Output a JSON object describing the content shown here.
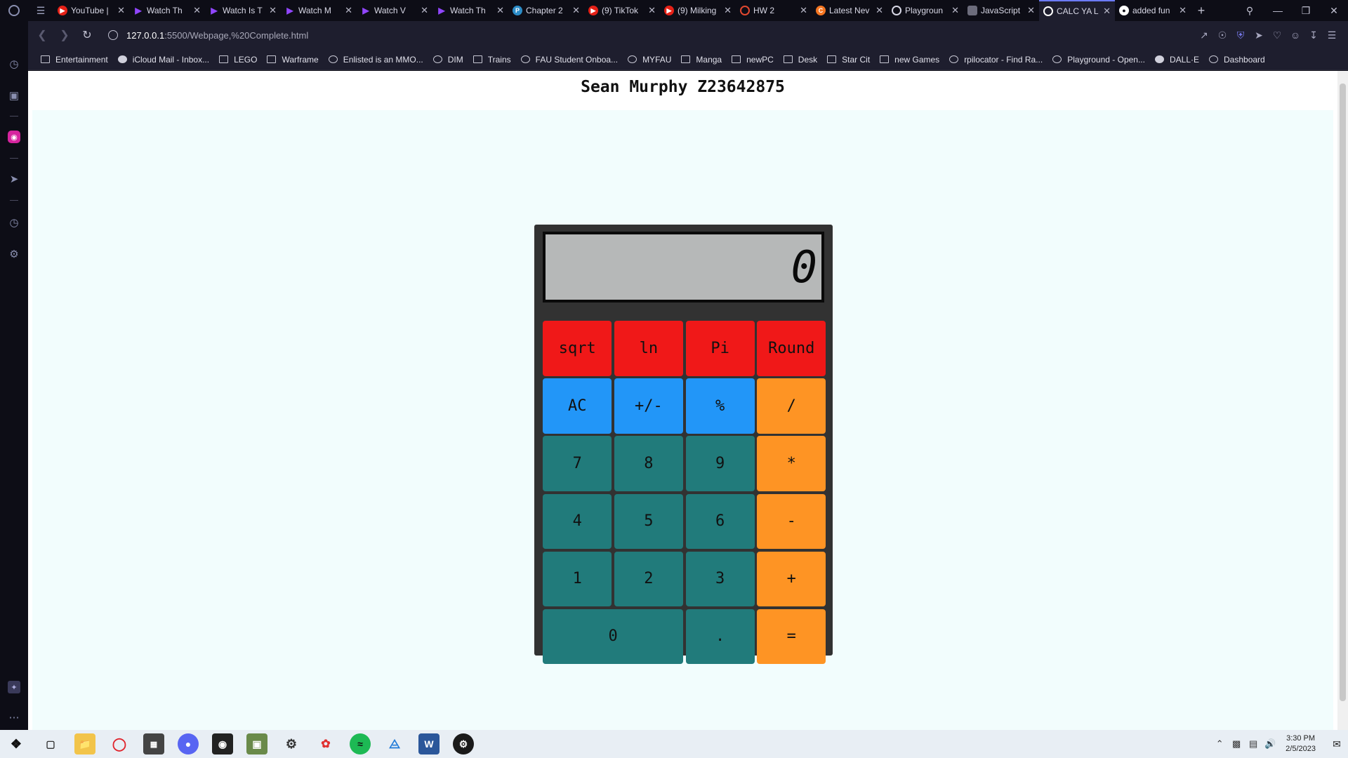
{
  "browser": {
    "tabs": [
      {
        "title": "YouTube | ",
        "favicon": "youtube-favicon",
        "color": "#e62117"
      },
      {
        "title": "Watch Th",
        "favicon": "twitch-favicon"
      },
      {
        "title": "Watch Is T",
        "favicon": "twitch-favicon"
      },
      {
        "title": "Watch M",
        "favicon": "twitch-favicon"
      },
      {
        "title": "Watch V",
        "favicon": "twitch-favicon"
      },
      {
        "title": "Watch Th",
        "favicon": "twitch-favicon"
      },
      {
        "title": "Chapter 2",
        "favicon": "perplexity-favicon"
      },
      {
        "title": "(9) TikTok",
        "favicon": "youtube-favicon"
      },
      {
        "title": "(9) Milking",
        "favicon": "youtube-favicon"
      },
      {
        "title": "HW 2",
        "favicon": "hw-favicon"
      },
      {
        "title": "Latest Nev",
        "favicon": "news-favicon"
      },
      {
        "title": "Playgroun",
        "favicon": "openai-favicon"
      },
      {
        "title": "JavaScript",
        "favicon": "javascript-favicon"
      },
      {
        "title": "CALC YA L",
        "favicon": "globe-favicon",
        "active": true
      },
      {
        "title": "added fun",
        "favicon": "github-favicon"
      }
    ],
    "new_tab": "+",
    "url_host": "127.0.0.1",
    "url_rest": ":5500/Webpage,%20Complete.html",
    "bookmarks": [
      {
        "label": "Entertainment",
        "icon": "folder-icon"
      },
      {
        "label": "iCloud Mail - Inbox...",
        "icon": "apple-icon"
      },
      {
        "label": "LEGO",
        "icon": "folder-icon"
      },
      {
        "label": "Warframe",
        "icon": "folder-icon"
      },
      {
        "label": "Enlisted is an MMO...",
        "icon": "enlisted-icon"
      },
      {
        "label": "DIM",
        "icon": "dim-icon"
      },
      {
        "label": "Trains",
        "icon": "folder-icon"
      },
      {
        "label": "FAU Student Onboa...",
        "icon": "fau-icon"
      },
      {
        "label": "MYFAU",
        "icon": "myfau-icon"
      },
      {
        "label": "Manga",
        "icon": "folder-icon"
      },
      {
        "label": "newPC",
        "icon": "folder-icon"
      },
      {
        "label": "Desk",
        "icon": "folder-icon"
      },
      {
        "label": "Star Cit",
        "icon": "folder-icon"
      },
      {
        "label": "new Games",
        "icon": "folder-icon"
      },
      {
        "label": "rpilocator - Find Ra...",
        "icon": "rpilocator-icon"
      },
      {
        "label": "Playground - Open...",
        "icon": "openai-icon"
      },
      {
        "label": "DALL·E",
        "icon": "dalle-icon"
      },
      {
        "label": "Dashboard",
        "icon": "dashboard-icon"
      }
    ]
  },
  "page": {
    "title": "Sean Murphy Z23642875"
  },
  "calculator": {
    "display": "0",
    "buttons": [
      {
        "label": "sqrt",
        "name": "sqrt-button",
        "color": "red"
      },
      {
        "label": "ln",
        "name": "ln-button",
        "color": "red"
      },
      {
        "label": "Pi",
        "name": "pi-button",
        "color": "red"
      },
      {
        "label": "Round",
        "name": "round-button",
        "color": "red"
      },
      {
        "label": "AC",
        "name": "all-clear-button",
        "color": "blue"
      },
      {
        "label": "+/-",
        "name": "negate-button",
        "color": "blue"
      },
      {
        "label": "%",
        "name": "percent-button",
        "color": "blue"
      },
      {
        "label": "/",
        "name": "divide-button",
        "color": "orange"
      },
      {
        "label": "7",
        "name": "digit-7-button",
        "color": "teal"
      },
      {
        "label": "8",
        "name": "digit-8-button",
        "color": "teal"
      },
      {
        "label": "9",
        "name": "digit-9-button",
        "color": "teal"
      },
      {
        "label": "*",
        "name": "multiply-button",
        "color": "orange"
      },
      {
        "label": "4",
        "name": "digit-4-button",
        "color": "teal"
      },
      {
        "label": "5",
        "name": "digit-5-button",
        "color": "teal"
      },
      {
        "label": "6",
        "name": "digit-6-button",
        "color": "teal"
      },
      {
        "label": "-",
        "name": "subtract-button",
        "color": "orange"
      },
      {
        "label": "1",
        "name": "digit-1-button",
        "color": "teal"
      },
      {
        "label": "2",
        "name": "digit-2-button",
        "color": "teal"
      },
      {
        "label": "3",
        "name": "digit-3-button",
        "color": "teal"
      },
      {
        "label": "+",
        "name": "add-button",
        "color": "orange"
      },
      {
        "label": "0",
        "name": "digit-0-button",
        "color": "teal"
      },
      {
        "label": ".",
        "name": "decimal-button",
        "color": "teal"
      },
      {
        "label": "=",
        "name": "equals-button",
        "color": "orange"
      }
    ],
    "colors": {
      "red": "#f01818",
      "blue": "#2296f8",
      "orange": "#fe9424",
      "teal": "#217b7b",
      "display": "#b6b8b8"
    }
  },
  "taskbar": {
    "time": "3:30 PM",
    "date": "2/5/2023"
  }
}
